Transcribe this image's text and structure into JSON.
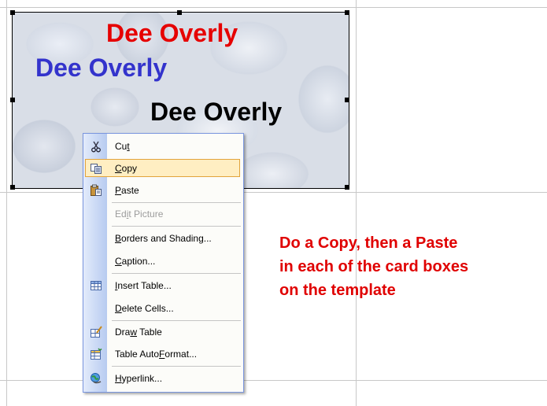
{
  "card": {
    "line1": "Dee Overly",
    "line2": "Dee Overly",
    "line3": "Dee Overly",
    "line1_color": "#e60000",
    "line2_color": "#3333cc",
    "line3_color": "#000000"
  },
  "context_menu": {
    "items": [
      {
        "label": "Cut",
        "mnemonic": "t",
        "icon": "scissors-icon",
        "enabled": true
      },
      {
        "label": "Copy",
        "mnemonic": "C",
        "icon": "copy-icon",
        "enabled": true,
        "highlighted": true
      },
      {
        "label": "Paste",
        "mnemonic": "P",
        "icon": "paste-icon",
        "enabled": true
      },
      {
        "label": "Edit Picture",
        "mnemonic": "i",
        "enabled": false
      },
      {
        "label": "Borders and Shading...",
        "mnemonic": "B",
        "enabled": true
      },
      {
        "label": "Caption...",
        "mnemonic": "C",
        "enabled": true
      },
      {
        "label": "Insert Table...",
        "mnemonic": "I",
        "icon": "insert-table-icon",
        "enabled": true
      },
      {
        "label": "Delete Cells...",
        "mnemonic": "D",
        "enabled": true
      },
      {
        "label": "Draw Table",
        "mnemonic": "w",
        "icon": "draw-table-icon",
        "enabled": true
      },
      {
        "label": "Table AutoFormat...",
        "mnemonic": "F",
        "icon": "table-autoformat-icon",
        "enabled": true
      },
      {
        "label": "Hyperlink...",
        "mnemonic": "H",
        "icon": "hyperlink-icon",
        "enabled": true
      }
    ]
  },
  "instructions": {
    "line1": "Do a Copy, then a Paste",
    "line2": "in each of the card boxes",
    "line3": "on the template",
    "color": "#e00000"
  }
}
